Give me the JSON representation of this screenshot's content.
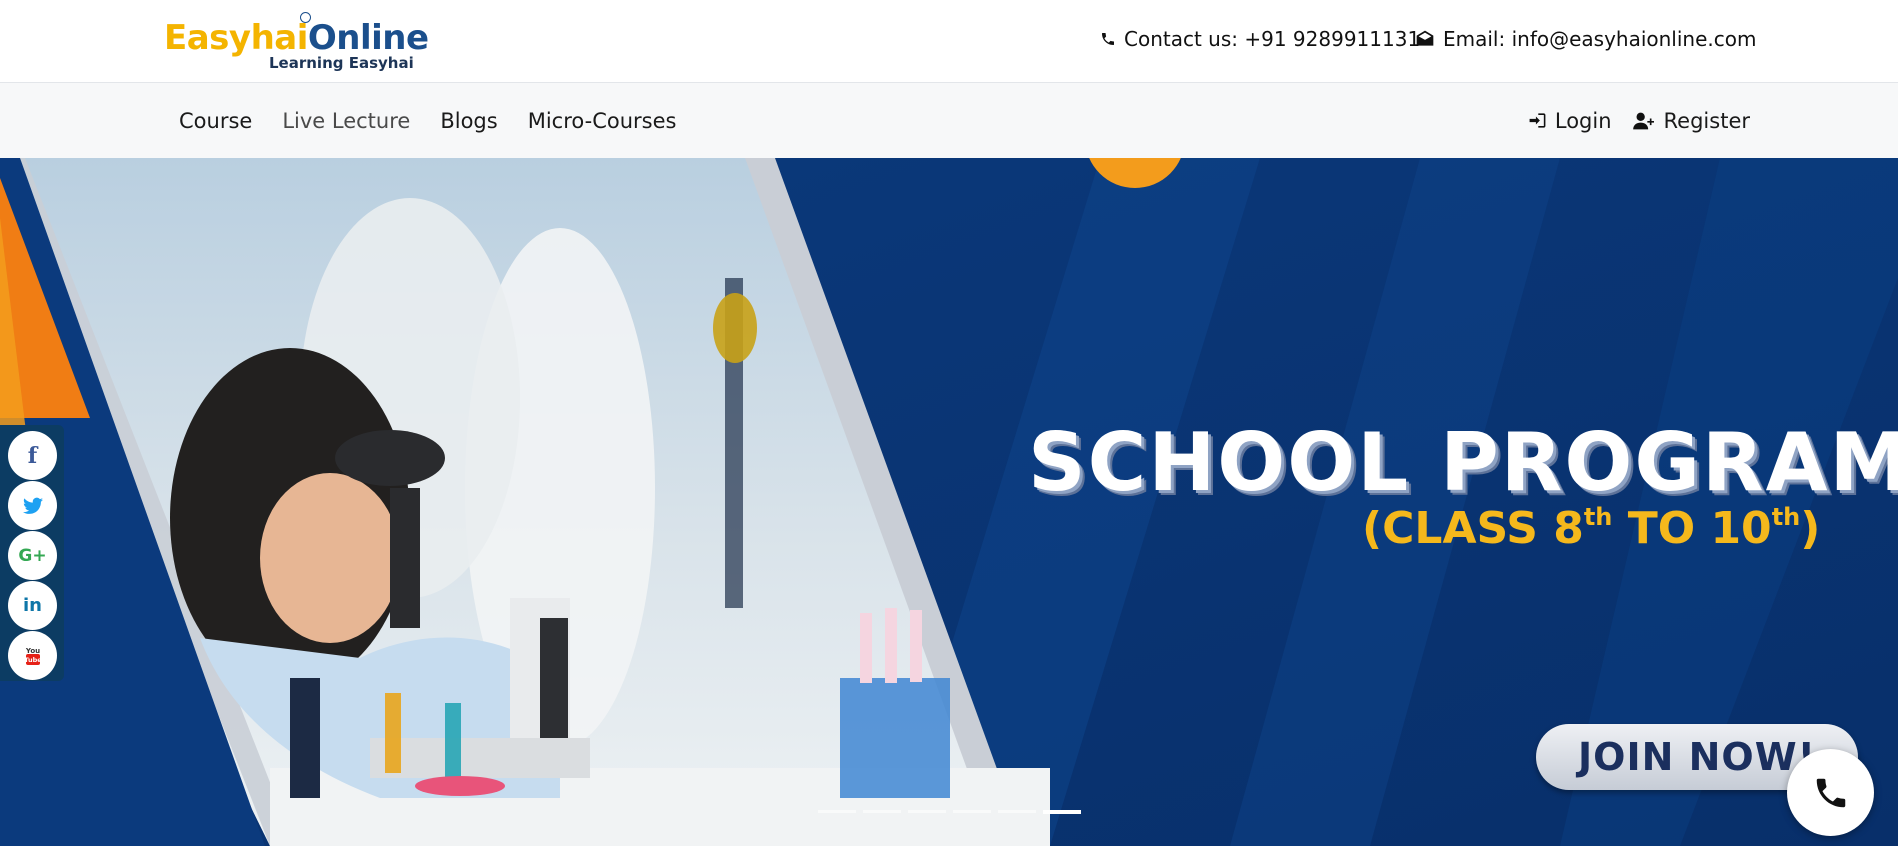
{
  "header": {
    "logo": {
      "brand_first": "Easyhai",
      "brand_second": "Online",
      "tagline": "Learning Easyhai"
    },
    "contact_text": "Contact us: +91 9289911131",
    "email_text": "Email: info@easyhaionline.com"
  },
  "nav": {
    "items": [
      {
        "label": "Course"
      },
      {
        "label": "Live Lecture"
      },
      {
        "label": "Blogs"
      },
      {
        "label": "Micro-Courses"
      }
    ],
    "login_label": "Login",
    "register_label": "Register"
  },
  "hero": {
    "title": "SCHOOL PROGRAM",
    "subtitle_parts": [
      "(CLASS 8",
      "th",
      " TO 10",
      "th",
      ")"
    ],
    "cta_label": "JOIN NOW!",
    "slide_count": 6,
    "active_slide": 6
  },
  "social": {
    "items": [
      {
        "name": "facebook-icon",
        "glyph": "f",
        "color": "#3b5998"
      },
      {
        "name": "twitter-icon",
        "glyph": "t",
        "color": "#1da1f2"
      },
      {
        "name": "google-plus-icon",
        "glyph": "G+",
        "color": "#34a853"
      },
      {
        "name": "linkedin-icon",
        "glyph": "in",
        "color": "#0e76a8"
      },
      {
        "name": "youtube-icon",
        "glyph": "You Tube",
        "color": "#e62117"
      }
    ]
  },
  "colors": {
    "brand_blue": "#1b4f8c",
    "brand_yellow": "#f4b400",
    "hero_blue": "#0a3878",
    "social_rail": "#0c3c63"
  }
}
